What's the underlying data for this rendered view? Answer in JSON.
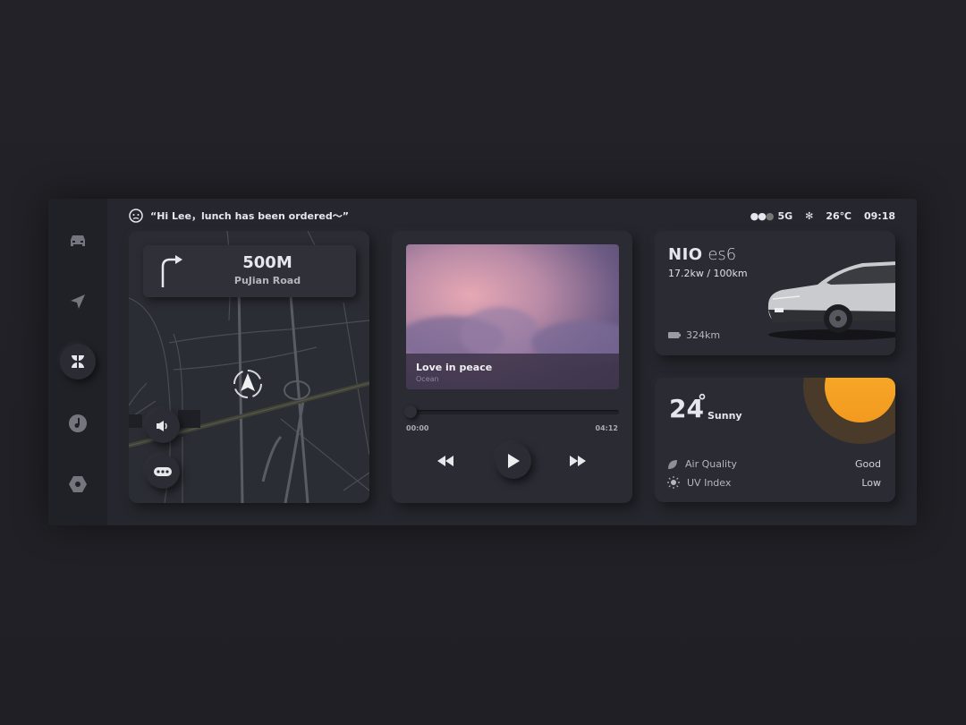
{
  "header": {
    "greeting": "“Hi Lee，lunch has been ordered～”",
    "signal": "5G",
    "temperature": "26℃",
    "time": "09:18"
  },
  "sidebar": {
    "items": [
      {
        "name": "car",
        "icon": "car-icon"
      },
      {
        "name": "navigation",
        "icon": "navigation-arrow-icon"
      },
      {
        "name": "apps",
        "icon": "apps-grid-icon",
        "active": true
      },
      {
        "name": "music",
        "icon": "music-icon"
      },
      {
        "name": "settings",
        "icon": "settings-hex-icon"
      }
    ]
  },
  "navigation": {
    "distance": "500M",
    "road": "PuJian Road",
    "direction": "turn-right"
  },
  "music": {
    "song": "Love in peace",
    "artist": "Ocean",
    "elapsed": "00:00",
    "duration": "04:12",
    "progress": 0
  },
  "car": {
    "brand": "NIO",
    "model": "es6",
    "efficiency": "17.2kw / 100km",
    "range": "324km"
  },
  "weather": {
    "temperature": "24",
    "condition": "Sunny",
    "rows": [
      {
        "label": "Air Quality",
        "value": "Good",
        "icon": "leaf-icon"
      },
      {
        "label": "UV Index",
        "value": "Low",
        "icon": "sun-icon"
      }
    ]
  },
  "colors": {
    "accent": "#f5a623",
    "background": "#26272e"
  }
}
